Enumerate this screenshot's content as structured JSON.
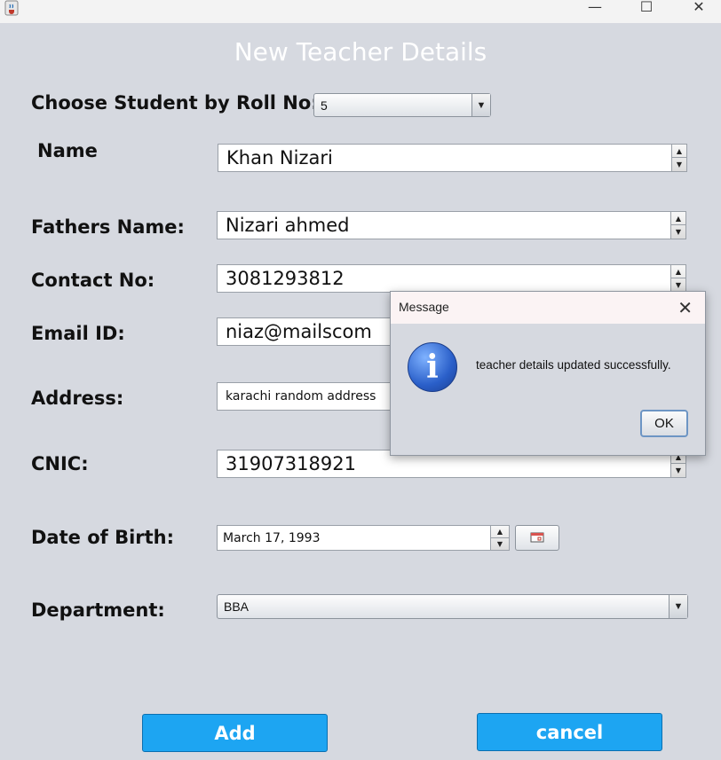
{
  "window": {
    "app_icon": "java-cup-icon",
    "minimize_glyph": "—",
    "maximize_glyph": "☐",
    "close_glyph": "✕"
  },
  "form": {
    "title": "New Teacher Details",
    "roll_label": "Choose Student by Roll No:",
    "roll_value": "5",
    "name_label": "Name",
    "name_value": "Khan Nizari",
    "fathers_label": "Fathers Name:",
    "fathers_value": "Nizari ahmed",
    "contact_label": "Contact No:",
    "contact_value": "3081293812",
    "email_label": "Email ID:",
    "email_value": "niaz@mailscom",
    "address_label": "Address:",
    "address_value": "karachi random address",
    "cnic_label": "CNIC:",
    "cnic_value": "31907318921",
    "dob_label": "Date of Birth:",
    "dob_value": "March 17, 1993",
    "department_label": "Department:",
    "department_value": "BBA",
    "add_label": "Add",
    "cancel_label": "cancel"
  },
  "dialog": {
    "title": "Message",
    "close_glyph": "✕",
    "icon": "info-icon",
    "icon_glyph": "i",
    "message": "teacher details updated successfully.",
    "ok_label": "OK"
  },
  "colors": {
    "background": "#d6d9e0",
    "button": "#1da5f2",
    "dialog_title": "#fbf3f4"
  }
}
